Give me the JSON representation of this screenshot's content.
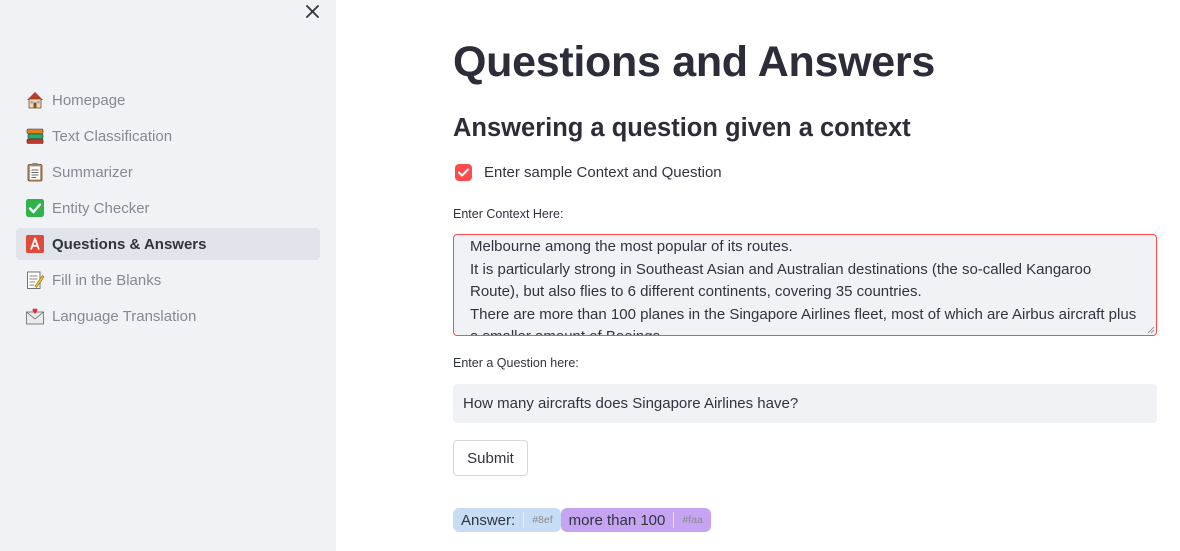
{
  "sidebar": {
    "items": [
      {
        "label": "Homepage",
        "icon": "house-icon"
      },
      {
        "label": "Text Classification",
        "icon": "books-icon"
      },
      {
        "label": "Summarizer",
        "icon": "clipboard-icon"
      },
      {
        "label": "Entity Checker",
        "icon": "check-mark-icon"
      },
      {
        "label": "Questions & Answers",
        "icon": "letter-a-icon"
      },
      {
        "label": "Fill in the Blanks",
        "icon": "memo-icon"
      },
      {
        "label": "Language Translation",
        "icon": "love-letter-icon"
      }
    ],
    "active_index": 4
  },
  "main": {
    "title": "Questions and Answers",
    "subtitle": "Answering a question given a context",
    "sample_checkbox": {
      "label": "Enter sample Context and Question",
      "checked": true
    },
    "context": {
      "label": "Enter Context Here:",
      "lines": [
        "Melbourne among the most popular of its routes.",
        "It is particularly strong in Southeast Asian and Australian destinations (the so-called Kangaroo",
        "Route), but also flies to 6 different continents, covering 35 countries.",
        "There are more than 100 planes in the Singapore Airlines fleet, most of which are Airbus aircraft plus",
        "a smaller amount of Boeings."
      ]
    },
    "question": {
      "label": "Enter a Question here:",
      "value": "How many aircrafts does Singapore Airlines have?"
    },
    "submit_label": "Submit",
    "answer": {
      "label": "Answer:",
      "label_code": "#8ef",
      "value": "more than 100",
      "value_code": "#faa"
    }
  },
  "colors": {
    "accent": "#ff4b4b",
    "sidebar_bg": "#f0f2f6",
    "answer_tag": "#c7ddf5",
    "value_tag": "#c5a4f2"
  }
}
